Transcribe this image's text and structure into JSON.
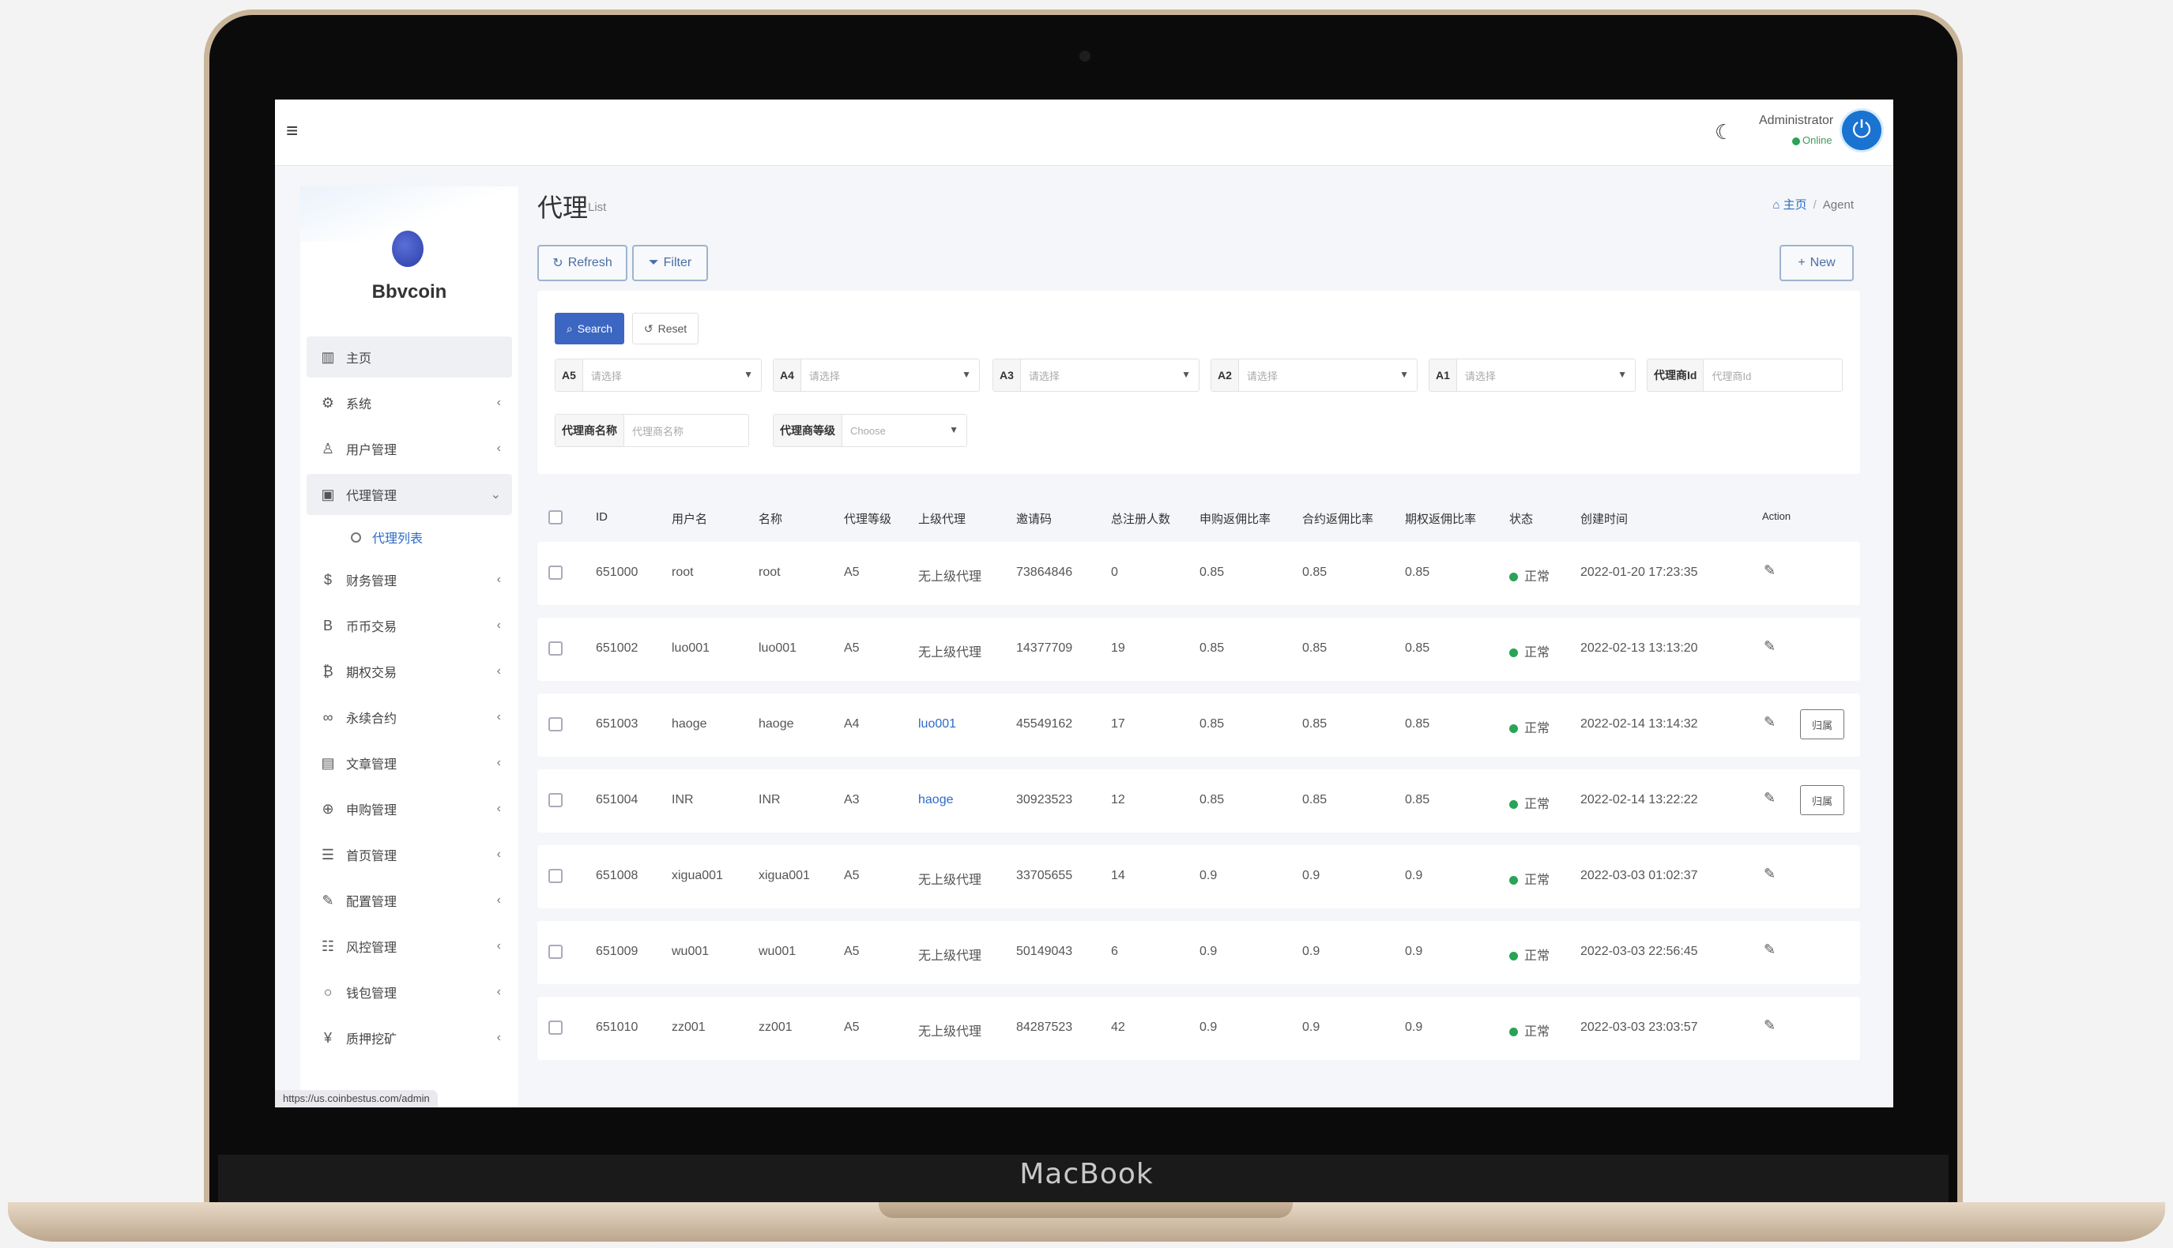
{
  "device": {
    "label": "MacBook"
  },
  "topbar": {
    "admin_name": "Administrator",
    "admin_status": "Online"
  },
  "sidebar": {
    "brand": "Bbvcoin",
    "menu": [
      {
        "label": "主页",
        "icon": "bar-chart-icon",
        "active": true
      },
      {
        "label": "系统",
        "icon": "gear-icon"
      },
      {
        "label": "用户管理",
        "icon": "user-icon"
      },
      {
        "label": "代理管理",
        "icon": "id-card-icon",
        "expanded": true
      },
      {
        "label": "财务管理",
        "icon": "dollar-icon"
      },
      {
        "label": "币币交易",
        "icon": "bitcoin-letter-icon"
      },
      {
        "label": "期权交易",
        "icon": "bitcoin-icon"
      },
      {
        "label": "永续合约",
        "icon": "link-icon"
      },
      {
        "label": "文章管理",
        "icon": "newspaper-icon"
      },
      {
        "label": "申购管理",
        "icon": "lifebuoy-icon"
      },
      {
        "label": "首页管理",
        "icon": "list-icon"
      },
      {
        "label": "配置管理",
        "icon": "wrench-icon"
      },
      {
        "label": "风控管理",
        "icon": "indent-list-icon"
      },
      {
        "label": "钱包管理",
        "icon": "circle-icon"
      },
      {
        "label": "质押挖矿",
        "icon": "yen-icon"
      }
    ],
    "submenu": {
      "label": "代理列表"
    }
  },
  "page": {
    "title": "代理",
    "subtitle": "List",
    "breadcrumb": {
      "home": "主页",
      "current": "Agent"
    }
  },
  "toolbar": {
    "refresh": "Refresh",
    "filter": "Filter",
    "new": "New"
  },
  "filters": {
    "search": "Search",
    "reset": "Reset",
    "fields": [
      {
        "label": "A5",
        "value": "请选择"
      },
      {
        "label": "A4",
        "value": "请选择"
      },
      {
        "label": "A3",
        "value": "请选择"
      },
      {
        "label": "A2",
        "value": "请选择"
      },
      {
        "label": "A1",
        "value": "请选择"
      },
      {
        "label": "代理商Id",
        "value": "代理商Id"
      },
      {
        "label": "代理商名称",
        "value": "代理商名称"
      },
      {
        "label": "代理商等级",
        "value": "Choose"
      }
    ]
  },
  "table": {
    "columns": [
      "ID",
      "用户名",
      "名称",
      "代理等级",
      "上级代理",
      "邀请码",
      "总注册人数",
      "申购返佣比率",
      "合约返佣比率",
      "期权返佣比率",
      "状态",
      "创建时间",
      "Action"
    ],
    "action_button": "归属",
    "rows": [
      {
        "id": "651000",
        "username": "root",
        "name": "root",
        "level": "A5",
        "parent": "无上级代理",
        "parent_link": false,
        "invite": "73864846",
        "registered": "0",
        "sub_rate": "0.85",
        "contract_rate": "0.85",
        "option_rate": "0.85",
        "status": "正常",
        "created": "2022-01-20 17:23:35",
        "has_assign": false
      },
      {
        "id": "651002",
        "username": "luo001",
        "name": "luo001",
        "level": "A5",
        "parent": "无上级代理",
        "parent_link": false,
        "invite": "14377709",
        "registered": "19",
        "sub_rate": "0.85",
        "contract_rate": "0.85",
        "option_rate": "0.85",
        "status": "正常",
        "created": "2022-02-13 13:13:20",
        "has_assign": false
      },
      {
        "id": "651003",
        "username": "haoge",
        "name": "haoge",
        "level": "A4",
        "parent": "luo001",
        "parent_link": true,
        "invite": "45549162",
        "registered": "17",
        "sub_rate": "0.85",
        "contract_rate": "0.85",
        "option_rate": "0.85",
        "status": "正常",
        "created": "2022-02-14 13:14:32",
        "has_assign": true
      },
      {
        "id": "651004",
        "username": "INR",
        "name": "INR",
        "level": "A3",
        "parent": "haoge",
        "parent_link": true,
        "invite": "30923523",
        "registered": "12",
        "sub_rate": "0.85",
        "contract_rate": "0.85",
        "option_rate": "0.85",
        "status": "正常",
        "created": "2022-02-14 13:22:22",
        "has_assign": true
      },
      {
        "id": "651008",
        "username": "xigua001",
        "name": "xigua001",
        "level": "A5",
        "parent": "无上级代理",
        "parent_link": false,
        "invite": "33705655",
        "registered": "14",
        "sub_rate": "0.9",
        "contract_rate": "0.9",
        "option_rate": "0.9",
        "status": "正常",
        "created": "2022-03-03 01:02:37",
        "has_assign": false
      },
      {
        "id": "651009",
        "username": "wu001",
        "name": "wu001",
        "level": "A5",
        "parent": "无上级代理",
        "parent_link": false,
        "invite": "50149043",
        "registered": "6",
        "sub_rate": "0.9",
        "contract_rate": "0.9",
        "option_rate": "0.9",
        "status": "正常",
        "created": "2022-03-03 22:56:45",
        "has_assign": false
      },
      {
        "id": "651010",
        "username": "zz001",
        "name": "zz001",
        "level": "A5",
        "parent": "无上级代理",
        "parent_link": false,
        "invite": "84287523",
        "registered": "42",
        "sub_rate": "0.9",
        "contract_rate": "0.9",
        "option_rate": "0.9",
        "status": "正常",
        "created": "2022-03-03 23:03:57",
        "has_assign": false
      }
    ]
  },
  "statusbar": {
    "url": "https://us.coinbestus.com/admin"
  }
}
